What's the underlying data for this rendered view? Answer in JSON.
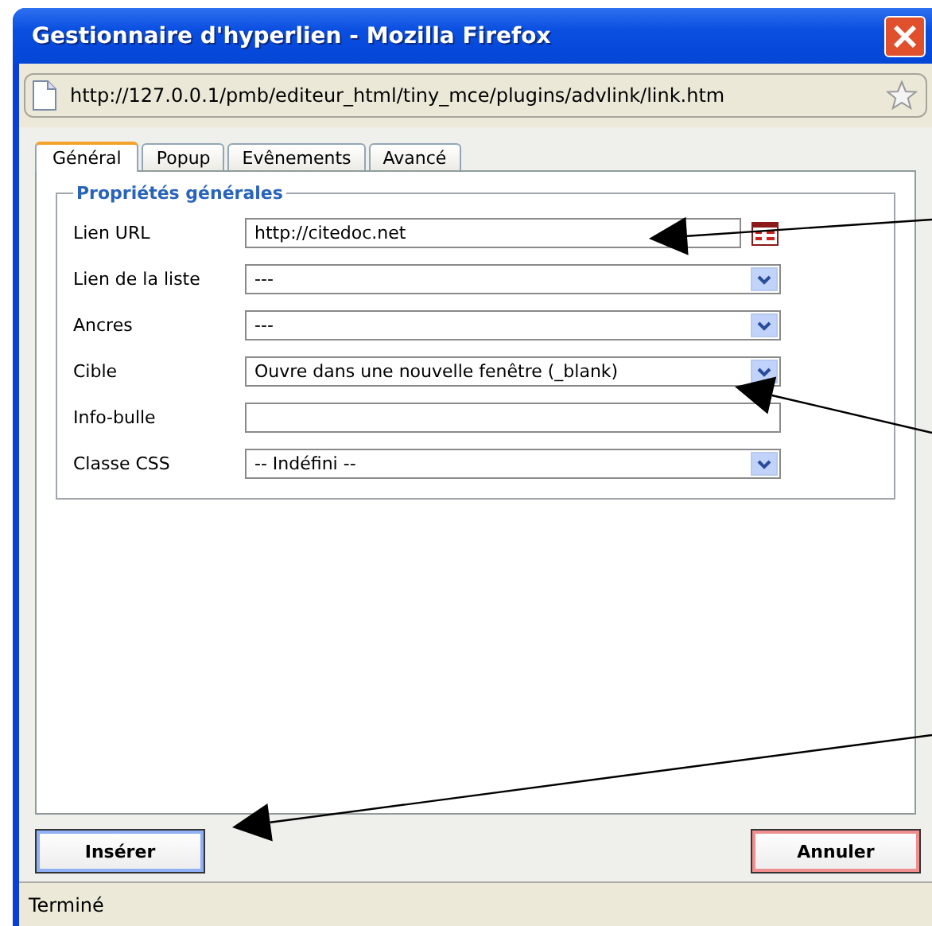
{
  "window": {
    "title": "Gestionnaire d'hyperlien - Mozilla Firefox"
  },
  "address_bar": {
    "url": "http://127.0.0.1/pmb/editeur_html/tiny_mce/plugins/advlink/link.htm"
  },
  "tabs": [
    {
      "label": "Général",
      "selected": true
    },
    {
      "label": "Popup",
      "selected": false
    },
    {
      "label": "Evênements",
      "selected": false
    },
    {
      "label": "Avancé",
      "selected": false
    }
  ],
  "fieldset": {
    "legend": "Propriétés générales"
  },
  "fields": [
    {
      "label": "Lien URL",
      "kind": "browse",
      "value": "http://citedoc.net"
    },
    {
      "label": "Lien de la liste",
      "kind": "select",
      "value": "---"
    },
    {
      "label": "Ancres",
      "kind": "select",
      "value": "---"
    },
    {
      "label": "Cible",
      "kind": "select",
      "value": "Ouvre dans une nouvelle fenêtre (_blank)"
    },
    {
      "label": "Info-bulle",
      "kind": "text"
    },
    {
      "label": "Classe CSS",
      "kind": "select",
      "value": "-- Indéfini --"
    }
  ],
  "buttons": [
    {
      "label": "Insérer",
      "kind": "primary"
    },
    {
      "label": "Annuler",
      "kind": "cancel"
    }
  ],
  "status_bar": {
    "text": "Terminé"
  }
}
